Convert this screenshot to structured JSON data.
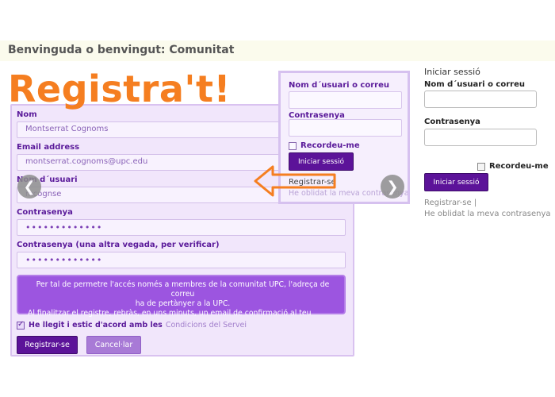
{
  "header": {
    "title": "Benvinguda o benvingut: Comunitat"
  },
  "hero": {
    "title": "Registra't!"
  },
  "register_form": {
    "fields": [
      {
        "label": "Nom",
        "value": "Montserrat Cognoms"
      },
      {
        "label": "Email address",
        "value": "montserrat.cognoms@upc.edu"
      },
      {
        "label": "Nom d´usuari",
        "value": "mcognse"
      },
      {
        "label": "Contrasenya",
        "value": "•••••••••••••"
      },
      {
        "label": "Contrasenya (una altra vegada, per verificar)",
        "value": "•••••••••••••"
      }
    ],
    "notice": {
      "line1": "Per tal de permetre l'accés només a membres de la comunitat UPC, l'adreça de correu",
      "line2": "ha de pertànyer a la UPC.",
      "line3": "Al finalitzar el registre, rebràs, en uns minuts, un email de confirmació al teu correu."
    },
    "agree_text": "He llegit i estic d'acord amb les",
    "agree_link": "Condicions del Servei",
    "register_button": "Registrar-se",
    "cancel_button": "Cancel·lar"
  },
  "zoom_login": {
    "username_label": "Nom d´usuari o correu",
    "password_label": "Contrasenya",
    "remember_label": "Recordeu-me",
    "login_button": "Iniciar sessió",
    "register_link": "Registrar-se",
    "forgot_link": "He oblidat la meva contrasenya"
  },
  "carousel": {
    "prev": "❮",
    "next": "❯"
  },
  "sidebar": {
    "title": "Iniciar sessió",
    "username_label": "Nom d´usuari o correu",
    "password_label": "Contrasenya",
    "remember_label": "Recordeu-me",
    "login_button": "Iniciar sessió",
    "register_link": "Registrar-se  |",
    "forgot_link": "He oblidat la meva contrasenya"
  },
  "colors": {
    "accent_orange": "#f57e20",
    "brand_purple": "#5c1399",
    "panel_lavender": "#f1e6fb"
  }
}
